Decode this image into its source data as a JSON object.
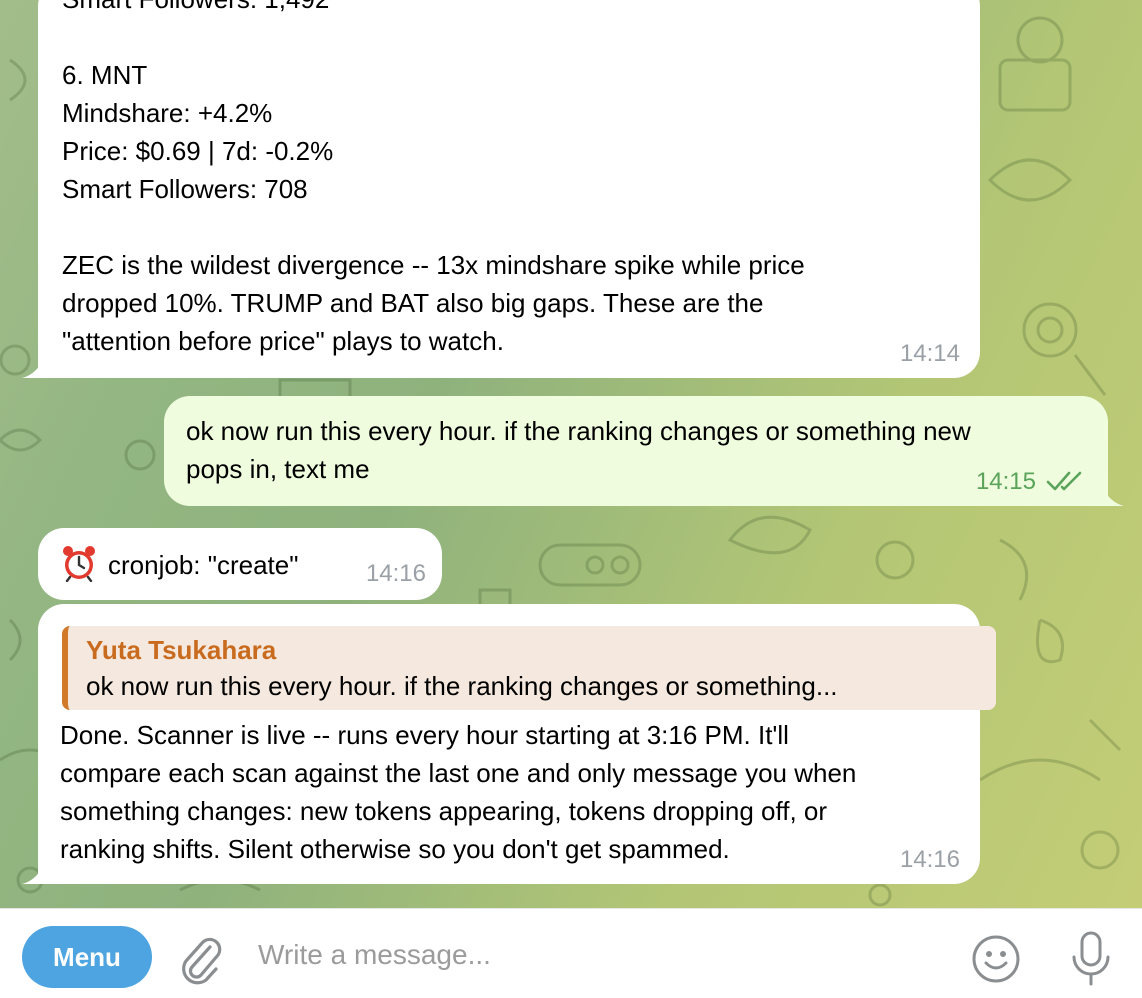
{
  "colors": {
    "incoming_bubble": "#ffffff",
    "outgoing_bubble": "#effdde",
    "outgoing_time": "#5aa35a",
    "menu_button": "#4ea4e0",
    "reply_accent": "#d07a2a"
  },
  "messages": [
    {
      "direction": "incoming",
      "text": "Smart Followers: 1,492\n\n6. MNT\nMindshare: +4.2%\nPrice: $0.69 | 7d: -0.2%\nSmart Followers: 708\n\nZEC is the wildest divergence -- 13x mindshare spike while price\ndropped 10%. TRUMP and BAT also big gaps. These are the\n\"attention before price\" plays to watch.",
      "time": "14:14"
    },
    {
      "direction": "outgoing",
      "text": "ok now run this every hour. if the ranking changes or something new\npops in, text me",
      "time": "14:15",
      "status_icon": "double-check-icon"
    },
    {
      "direction": "incoming",
      "icon": "alarm-clock-icon",
      "text": "cronjob: \"create\"",
      "time": "14:16"
    },
    {
      "direction": "incoming",
      "reply_to": {
        "author": "Yuta Tsukahara",
        "text": "ok now run this every hour. if the ranking changes or something..."
      },
      "text": "Done. Scanner is live -- runs every hour starting at 3:16 PM. It'll\ncompare each scan against the last one and only message you when\nsomething changes: new tokens appearing, tokens dropping off, or\nranking shifts. Silent otherwise so you don't get spammed.",
      "time": "14:16"
    }
  ],
  "composer": {
    "menu_label": "Menu",
    "placeholder": "Write a message...",
    "value": "",
    "icons": [
      "paperclip-icon",
      "emoji-icon",
      "microphone-icon"
    ]
  }
}
